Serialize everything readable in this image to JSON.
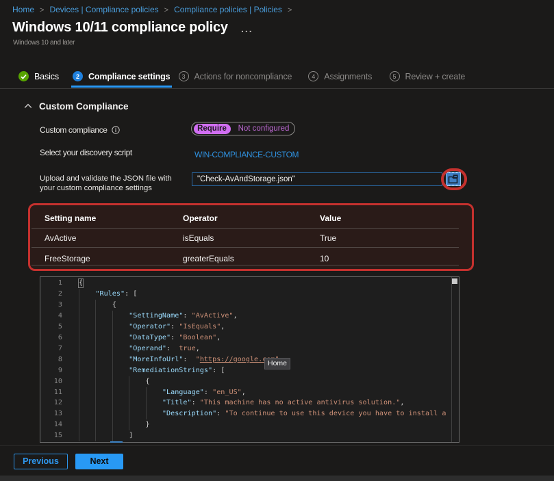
{
  "breadcrumb": {
    "items": [
      "Home",
      "Devices | Compliance policies",
      "Compliance policies | Policies"
    ],
    "separator": ">",
    "trailing_separator": ">"
  },
  "header": {
    "title": "Windows 10/11 compliance policy",
    "more_label": "...",
    "subtitle": "Windows 10 and later"
  },
  "steps": [
    {
      "label": "Basics",
      "state": "complete",
      "icon": "check"
    },
    {
      "label": "Compliance settings",
      "num": "2",
      "state": "active"
    },
    {
      "label": "Actions for noncompliance",
      "num": "3",
      "state": "upcoming"
    },
    {
      "label": "Assignments",
      "num": "4",
      "state": "upcoming"
    },
    {
      "label": "Review + create",
      "num": "5",
      "state": "upcoming"
    }
  ],
  "section": {
    "title": "Custom Compliance"
  },
  "form": {
    "custom_compliance_label": "Custom compliance",
    "toggle": {
      "selected": "Require",
      "unselected": "Not configured"
    },
    "discovery_label": "Select your discovery script",
    "discovery_value": "WIN-COMPLIANCE-CUSTOM",
    "upload_label_line1": "Upload and validate the JSON file with",
    "upload_label_line2": "your custom compliance settings",
    "upload_value": "\"Check-AvAndStorage.json\""
  },
  "table": {
    "columns": [
      "Setting name",
      "Operator",
      "Value"
    ],
    "rows": [
      [
        "AvActive",
        "isEquals",
        "True"
      ],
      [
        "FreeStorage",
        "greaterEquals",
        "10"
      ]
    ]
  },
  "editor": {
    "tooltip": "Home",
    "lines": [
      {
        "n": 1,
        "tokens": [
          [
            "p",
            "{"
          ]
        ]
      },
      {
        "n": 2,
        "tokens": [
          [
            "p",
            "    "
          ],
          [
            "k",
            "\"Rules\""
          ],
          [
            "p",
            ": ["
          ]
        ]
      },
      {
        "n": 3,
        "tokens": [
          [
            "p",
            "        {"
          ]
        ]
      },
      {
        "n": 4,
        "tokens": [
          [
            "p",
            "            "
          ],
          [
            "k",
            "\"SettingName\""
          ],
          [
            "p",
            ": "
          ],
          [
            "s",
            "\"AvActive\""
          ],
          [
            "p",
            ","
          ]
        ]
      },
      {
        "n": 5,
        "tokens": [
          [
            "p",
            "            "
          ],
          [
            "k",
            "\"Operator\""
          ],
          [
            "p",
            ": "
          ],
          [
            "s",
            "\"IsEquals\""
          ],
          [
            "p",
            ","
          ]
        ]
      },
      {
        "n": 6,
        "tokens": [
          [
            "p",
            "            "
          ],
          [
            "k",
            "\"DataType\""
          ],
          [
            "p",
            ": "
          ],
          [
            "s",
            "\"Boolean\""
          ],
          [
            "p",
            ","
          ]
        ]
      },
      {
        "n": 7,
        "tokens": [
          [
            "p",
            "            "
          ],
          [
            "k",
            "\"Operand\""
          ],
          [
            "p",
            ":  "
          ],
          [
            "kw",
            "true"
          ],
          [
            "p",
            ","
          ]
        ]
      },
      {
        "n": 8,
        "tokens": [
          [
            "p",
            "            "
          ],
          [
            "k",
            "\"MoreInfoUrl\""
          ],
          [
            "p",
            ":  "
          ],
          [
            "s",
            "\""
          ],
          [
            "a",
            "https://google.com"
          ],
          [
            "s",
            "\""
          ],
          [
            "p",
            ","
          ]
        ]
      },
      {
        "n": 9,
        "tokens": [
          [
            "p",
            "            "
          ],
          [
            "k",
            "\"RemediationStrings\""
          ],
          [
            "p",
            ": ["
          ]
        ]
      },
      {
        "n": 10,
        "tokens": [
          [
            "p",
            "                {"
          ]
        ]
      },
      {
        "n": 11,
        "tokens": [
          [
            "p",
            "                    "
          ],
          [
            "k",
            "\"Language\""
          ],
          [
            "p",
            ": "
          ],
          [
            "s",
            "\"en_US\""
          ],
          [
            "p",
            ","
          ]
        ]
      },
      {
        "n": 12,
        "tokens": [
          [
            "p",
            "                    "
          ],
          [
            "k",
            "\"Title\""
          ],
          [
            "p",
            ": "
          ],
          [
            "s",
            "\"This machine has no active antivirus solution.\""
          ],
          [
            "p",
            ","
          ]
        ]
      },
      {
        "n": 13,
        "tokens": [
          [
            "p",
            "                    "
          ],
          [
            "k",
            "\"Description\""
          ],
          [
            "p",
            ": "
          ],
          [
            "s",
            "\"To continue to use this device you have to install a"
          ]
        ]
      },
      {
        "n": 14,
        "tokens": [
          [
            "p",
            "                }"
          ]
        ]
      },
      {
        "n": 15,
        "tokens": [
          [
            "p",
            "            ]"
          ]
        ]
      }
    ]
  },
  "footer": {
    "previous": "Previous",
    "next": "Next"
  },
  "colors": {
    "accent_blue": "#2899f5",
    "link_blue": "#4a9edd",
    "toggle_magenta": "#cf6cf0",
    "annotation_red": "#c5312e",
    "complete_green": "#57a300"
  }
}
